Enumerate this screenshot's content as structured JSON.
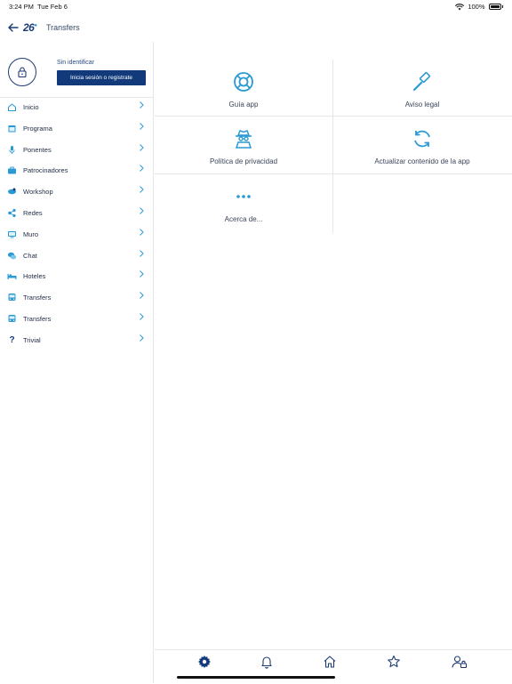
{
  "status_bar": {
    "time": "3:24 PM",
    "date": "Tue Feb 6",
    "battery": "100%"
  },
  "header": {
    "logo_number": "26",
    "title": "Transfers"
  },
  "profile": {
    "status": "Sin identificar",
    "login_button": "Inicia sesión o registrate"
  },
  "menu": [
    {
      "label": "Inicio",
      "icon": "home-icon"
    },
    {
      "label": "Programa",
      "icon": "calendar-icon"
    },
    {
      "label": "Ponentes",
      "icon": "microphone-icon"
    },
    {
      "label": "Patrocinadores",
      "icon": "briefcase-icon"
    },
    {
      "label": "Workshop",
      "icon": "workshop-icon"
    },
    {
      "label": "Redes",
      "icon": "network-icon"
    },
    {
      "label": "Muro",
      "icon": "monitor-icon"
    },
    {
      "label": "Chat",
      "icon": "chat-icon"
    },
    {
      "label": "Hoteles",
      "icon": "bed-icon"
    },
    {
      "label": "Transfers",
      "icon": "bus-icon"
    },
    {
      "label": "Transfers",
      "icon": "bus-icon"
    },
    {
      "label": "Trivial",
      "icon": "question-icon"
    }
  ],
  "tiles": [
    {
      "label": "Guía app",
      "icon": "lifebuoy-icon"
    },
    {
      "label": "Aviso legal",
      "icon": "gavel-icon"
    },
    {
      "label": "Política de privacidad",
      "icon": "spy-icon"
    },
    {
      "label": "Actualizar contenido de la app",
      "icon": "refresh-icon"
    },
    {
      "label": "Acerca de...",
      "icon": "more-dots-icon"
    }
  ],
  "tabbar": [
    {
      "icon": "gear-icon",
      "active": true
    },
    {
      "icon": "bell-icon",
      "active": false
    },
    {
      "icon": "home-icon",
      "active": false
    },
    {
      "icon": "star-icon",
      "active": false
    },
    {
      "icon": "user-lock-icon",
      "active": false
    }
  ],
  "colors": {
    "primary": "#123a7a",
    "accent": "#2a9ad6",
    "text": "#1f2a44",
    "divider": "#e6e6e6"
  }
}
